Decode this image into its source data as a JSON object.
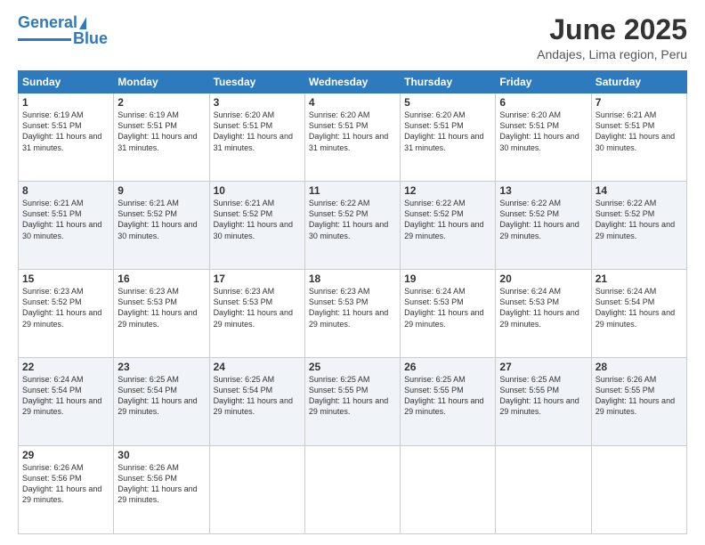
{
  "logo": {
    "text_general": "General",
    "text_blue": "Blue"
  },
  "title": "June 2025",
  "subtitle": "Andajes, Lima region, Peru",
  "days_of_week": [
    "Sunday",
    "Monday",
    "Tuesday",
    "Wednesday",
    "Thursday",
    "Friday",
    "Saturday"
  ],
  "weeks": [
    [
      {
        "day": "1",
        "sunrise": "6:19 AM",
        "sunset": "5:51 PM",
        "daylight": "11 hours and 31 minutes."
      },
      {
        "day": "2",
        "sunrise": "6:19 AM",
        "sunset": "5:51 PM",
        "daylight": "11 hours and 31 minutes."
      },
      {
        "day": "3",
        "sunrise": "6:20 AM",
        "sunset": "5:51 PM",
        "daylight": "11 hours and 31 minutes."
      },
      {
        "day": "4",
        "sunrise": "6:20 AM",
        "sunset": "5:51 PM",
        "daylight": "11 hours and 31 minutes."
      },
      {
        "day": "5",
        "sunrise": "6:20 AM",
        "sunset": "5:51 PM",
        "daylight": "11 hours and 31 minutes."
      },
      {
        "day": "6",
        "sunrise": "6:20 AM",
        "sunset": "5:51 PM",
        "daylight": "11 hours and 30 minutes."
      },
      {
        "day": "7",
        "sunrise": "6:21 AM",
        "sunset": "5:51 PM",
        "daylight": "11 hours and 30 minutes."
      }
    ],
    [
      {
        "day": "8",
        "sunrise": "6:21 AM",
        "sunset": "5:51 PM",
        "daylight": "11 hours and 30 minutes."
      },
      {
        "day": "9",
        "sunrise": "6:21 AM",
        "sunset": "5:52 PM",
        "daylight": "11 hours and 30 minutes."
      },
      {
        "day": "10",
        "sunrise": "6:21 AM",
        "sunset": "5:52 PM",
        "daylight": "11 hours and 30 minutes."
      },
      {
        "day": "11",
        "sunrise": "6:22 AM",
        "sunset": "5:52 PM",
        "daylight": "11 hours and 30 minutes."
      },
      {
        "day": "12",
        "sunrise": "6:22 AM",
        "sunset": "5:52 PM",
        "daylight": "11 hours and 29 minutes."
      },
      {
        "day": "13",
        "sunrise": "6:22 AM",
        "sunset": "5:52 PM",
        "daylight": "11 hours and 29 minutes."
      },
      {
        "day": "14",
        "sunrise": "6:22 AM",
        "sunset": "5:52 PM",
        "daylight": "11 hours and 29 minutes."
      }
    ],
    [
      {
        "day": "15",
        "sunrise": "6:23 AM",
        "sunset": "5:52 PM",
        "daylight": "11 hours and 29 minutes."
      },
      {
        "day": "16",
        "sunrise": "6:23 AM",
        "sunset": "5:53 PM",
        "daylight": "11 hours and 29 minutes."
      },
      {
        "day": "17",
        "sunrise": "6:23 AM",
        "sunset": "5:53 PM",
        "daylight": "11 hours and 29 minutes."
      },
      {
        "day": "18",
        "sunrise": "6:23 AM",
        "sunset": "5:53 PM",
        "daylight": "11 hours and 29 minutes."
      },
      {
        "day": "19",
        "sunrise": "6:24 AM",
        "sunset": "5:53 PM",
        "daylight": "11 hours and 29 minutes."
      },
      {
        "day": "20",
        "sunrise": "6:24 AM",
        "sunset": "5:53 PM",
        "daylight": "11 hours and 29 minutes."
      },
      {
        "day": "21",
        "sunrise": "6:24 AM",
        "sunset": "5:54 PM",
        "daylight": "11 hours and 29 minutes."
      }
    ],
    [
      {
        "day": "22",
        "sunrise": "6:24 AM",
        "sunset": "5:54 PM",
        "daylight": "11 hours and 29 minutes."
      },
      {
        "day": "23",
        "sunrise": "6:25 AM",
        "sunset": "5:54 PM",
        "daylight": "11 hours and 29 minutes."
      },
      {
        "day": "24",
        "sunrise": "6:25 AM",
        "sunset": "5:54 PM",
        "daylight": "11 hours and 29 minutes."
      },
      {
        "day": "25",
        "sunrise": "6:25 AM",
        "sunset": "5:55 PM",
        "daylight": "11 hours and 29 minutes."
      },
      {
        "day": "26",
        "sunrise": "6:25 AM",
        "sunset": "5:55 PM",
        "daylight": "11 hours and 29 minutes."
      },
      {
        "day": "27",
        "sunrise": "6:25 AM",
        "sunset": "5:55 PM",
        "daylight": "11 hours and 29 minutes."
      },
      {
        "day": "28",
        "sunrise": "6:26 AM",
        "sunset": "5:55 PM",
        "daylight": "11 hours and 29 minutes."
      }
    ],
    [
      {
        "day": "29",
        "sunrise": "6:26 AM",
        "sunset": "5:56 PM",
        "daylight": "11 hours and 29 minutes."
      },
      {
        "day": "30",
        "sunrise": "6:26 AM",
        "sunset": "5:56 PM",
        "daylight": "11 hours and 29 minutes."
      },
      null,
      null,
      null,
      null,
      null
    ]
  ],
  "labels": {
    "sunrise": "Sunrise:",
    "sunset": "Sunset:",
    "daylight": "Daylight:"
  }
}
